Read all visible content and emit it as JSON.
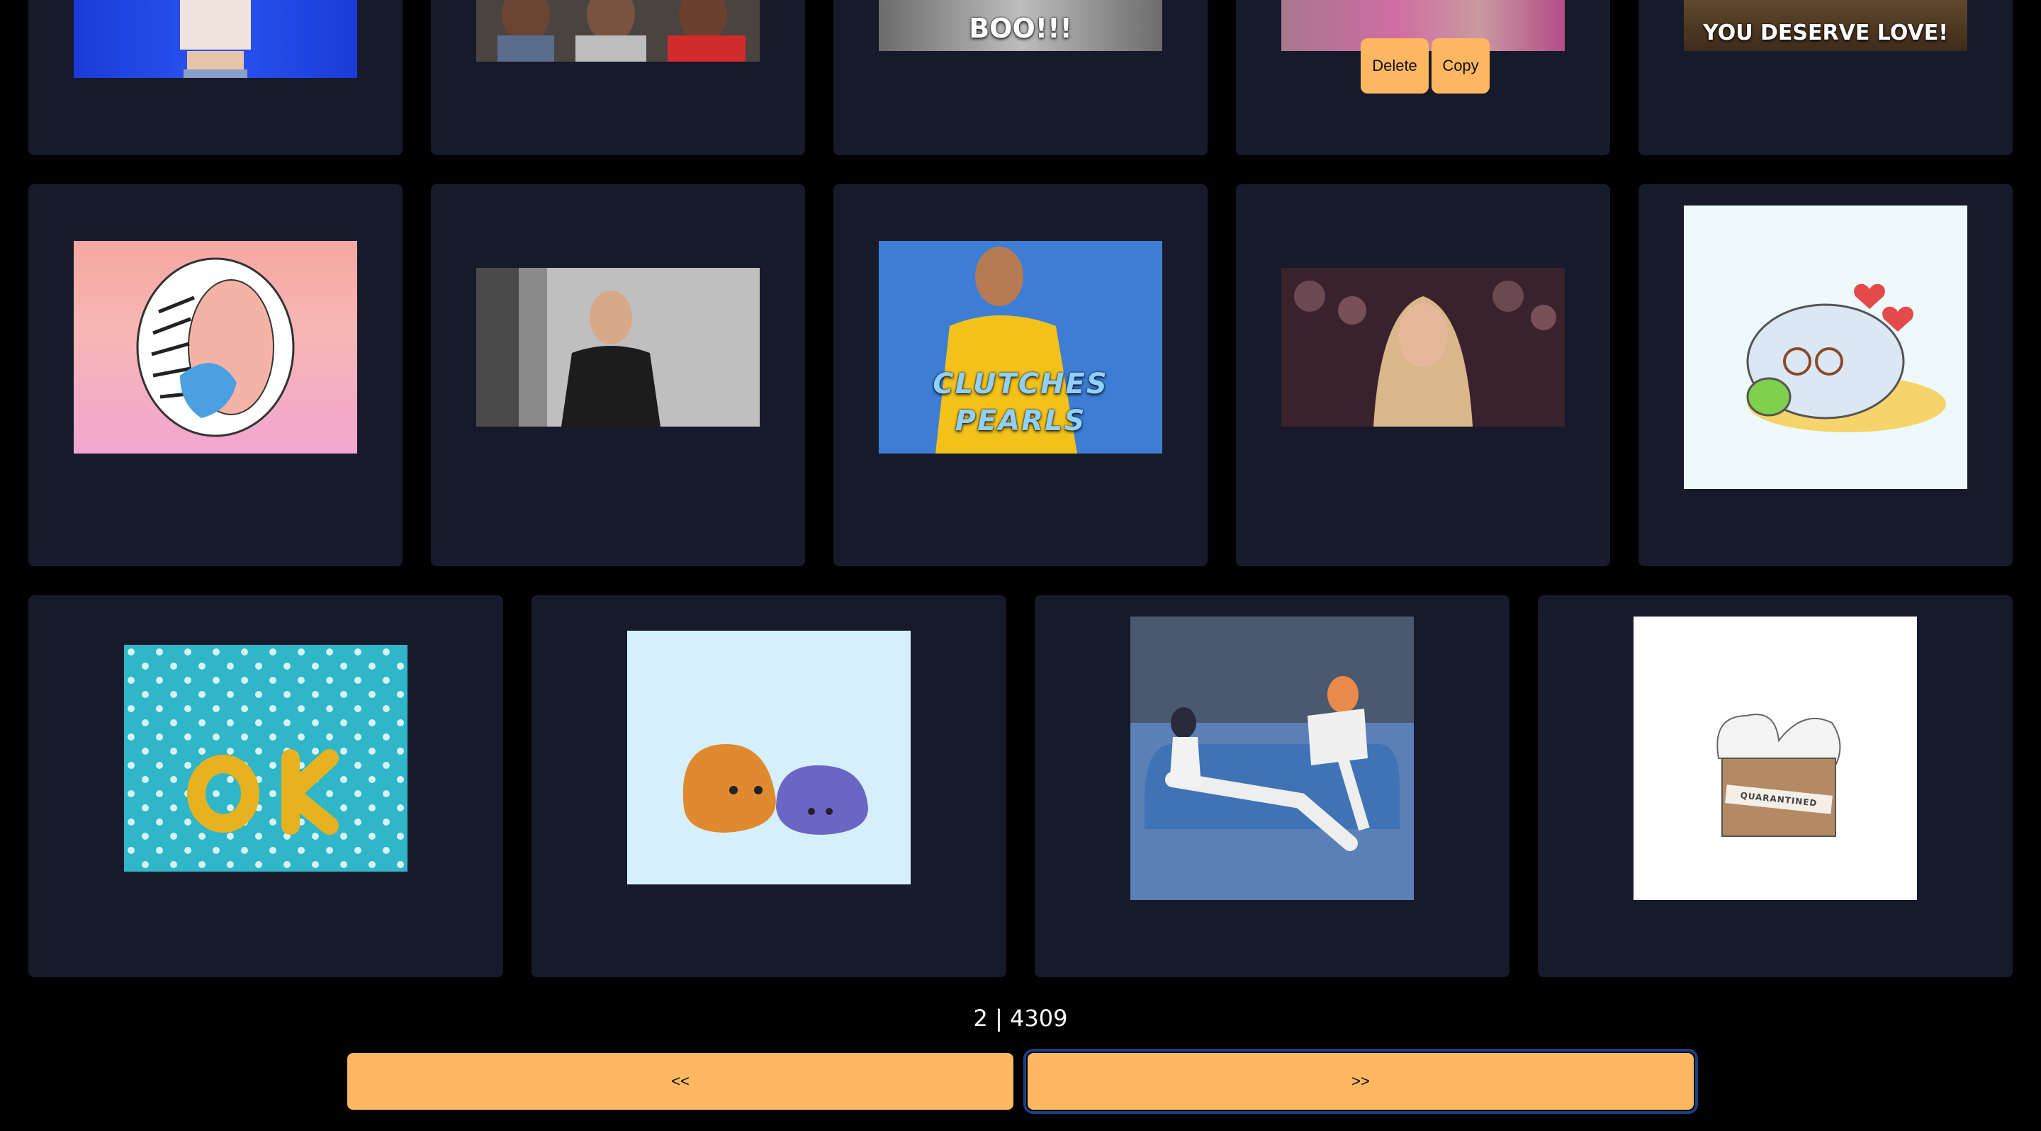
{
  "gifs": {
    "r0c2_caption": "BOO!!!",
    "r0c4_caption": "YOU DESERVE LOVE!",
    "clutches_caption": "CLUTCHES PEARLS",
    "ok_caption": "OK",
    "quarantined_caption": "QUARANTINED"
  },
  "actions": {
    "delete_label": "Delete",
    "copy_label": "Copy"
  },
  "pager": {
    "text": "2 | 4309",
    "prev_label": "<<",
    "next_label": ">>"
  },
  "colors": {
    "background": "#000000",
    "card": "#161a2b",
    "accent": "#ffb762",
    "focus_ring": "#1a3f86"
  }
}
